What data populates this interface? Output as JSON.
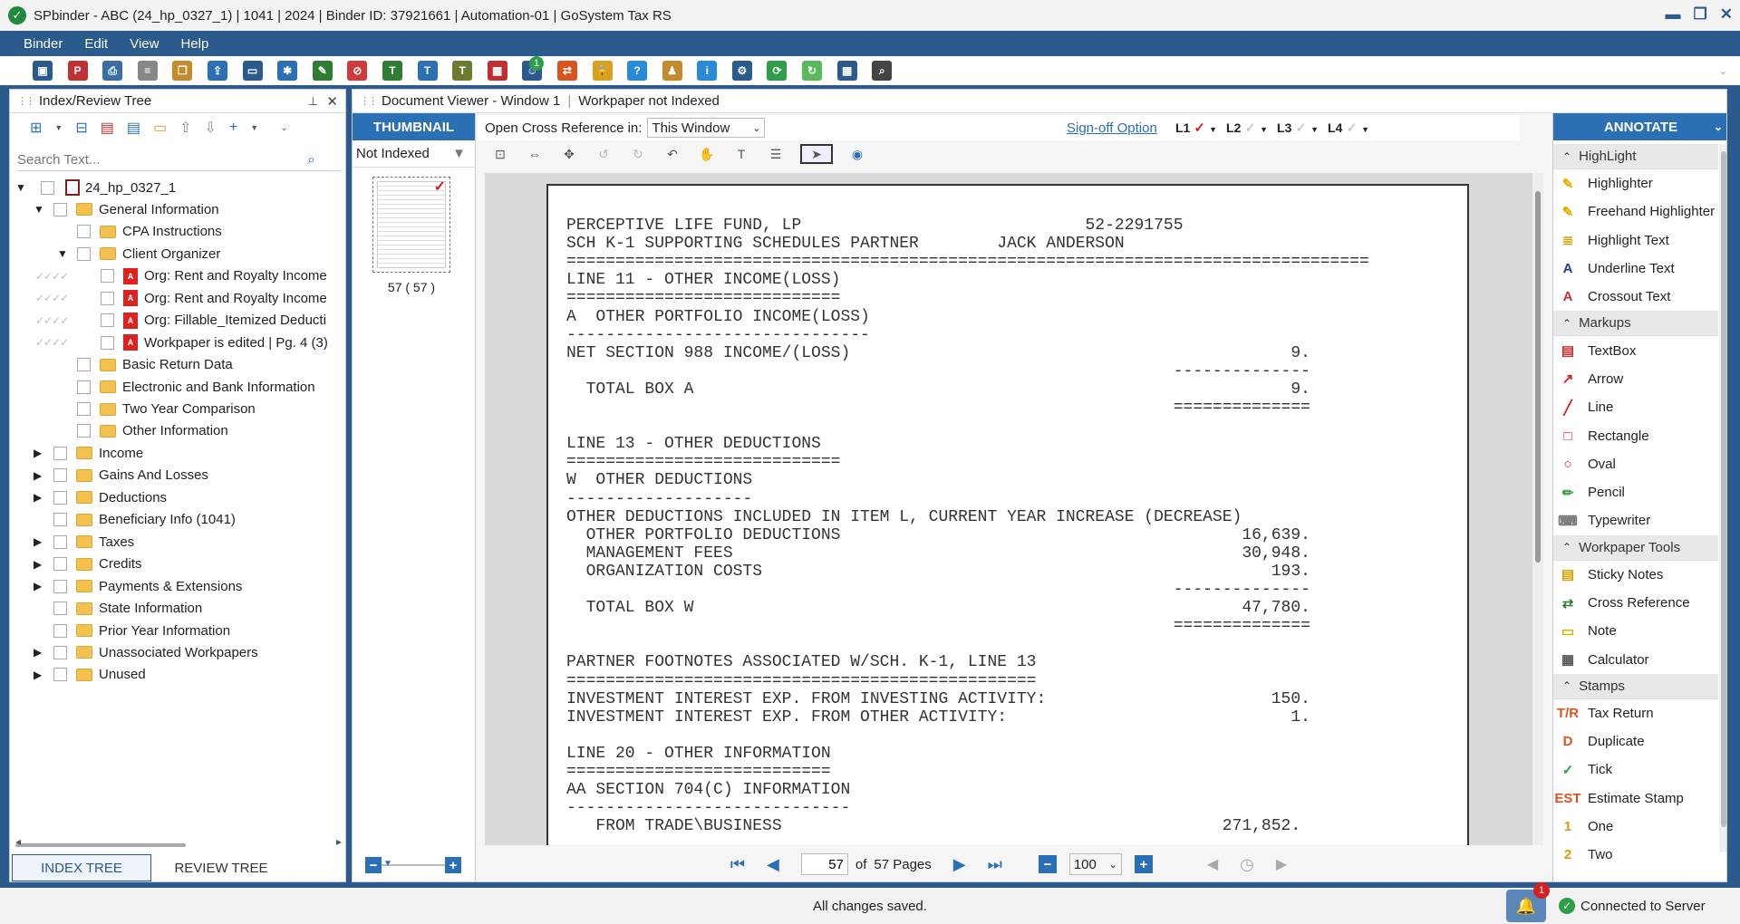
{
  "window": {
    "title": "SPbinder - ABC (24_hp_0327_1) | 1041 | 2024 | Binder ID: 37921661 | Automation-01 | GoSystem Tax RS",
    "controls": [
      "▬",
      "❐",
      "✕"
    ]
  },
  "menu": [
    "Binder",
    "Edit",
    "View",
    "Help"
  ],
  "toolbar": {
    "notification_count": "1",
    "icons": [
      {
        "name": "save-icon",
        "color": "#2b5a8c",
        "glyph": "▣"
      },
      {
        "name": "pdfx-icon",
        "color": "#c03030",
        "glyph": "P"
      },
      {
        "name": "print-icon",
        "color": "#3a6ea5",
        "glyph": "⎙"
      },
      {
        "name": "document-icon",
        "color": "#888",
        "glyph": "≡"
      },
      {
        "name": "copy-doc-icon",
        "color": "#c48a2c",
        "glyph": "❐"
      },
      {
        "name": "export-icon",
        "color": "#2b6fb5",
        "glyph": "⇪"
      },
      {
        "name": "monitor-icon",
        "color": "#2b5a8c",
        "glyph": "▭"
      },
      {
        "name": "tools-icon",
        "color": "#2b6fb5",
        "glyph": "✱"
      },
      {
        "name": "user-sign-icon",
        "color": "#2e7d32",
        "glyph": "✎"
      },
      {
        "name": "no-entry-icon",
        "color": "#d13a3a",
        "glyph": "⊘"
      },
      {
        "name": "tei-icon",
        "color": "#2e7d32",
        "glyph": "T"
      },
      {
        "name": "tax-icon",
        "color": "#2b6fb5",
        "glyph": "T"
      },
      {
        "name": "tr-icon",
        "color": "#6a7d2e",
        "glyph": "T"
      },
      {
        "name": "calendar-icon",
        "color": "#c03030",
        "glyph": "▦"
      },
      {
        "name": "users-icon",
        "color": "#2b5a8c",
        "glyph": "☺"
      },
      {
        "name": "swap-icon",
        "color": "#d9541e",
        "glyph": "⇄"
      },
      {
        "name": "lock-icon",
        "color": "#d9a020",
        "glyph": "🔒"
      },
      {
        "name": "help-icon",
        "color": "#2b8ad6",
        "glyph": "?"
      },
      {
        "name": "user-key-icon",
        "color": "#c48a2c",
        "glyph": "♟"
      },
      {
        "name": "info-icon",
        "color": "#2b8ad6",
        "glyph": "i"
      },
      {
        "name": "settings-icon",
        "color": "#2b5a8c",
        "glyph": "⚙"
      },
      {
        "name": "sync-icon",
        "color": "#2e9e4a",
        "glyph": "⟳"
      },
      {
        "name": "refresh-green-icon",
        "color": "#5cb85c",
        "glyph": "↻"
      },
      {
        "name": "grid-icon",
        "color": "#2b5a8c",
        "glyph": "▦"
      },
      {
        "name": "search-icon",
        "color": "#444",
        "glyph": "⌕"
      }
    ]
  },
  "index_panel": {
    "title": "Index/Review Tree",
    "search_placeholder": "Search Text...",
    "tabs": [
      "INDEX TREE",
      "REVIEW TREE"
    ],
    "root": "24_hp_0327_1",
    "items": [
      {
        "label": "General Information",
        "level": 1,
        "expander": "▼",
        "type": "folder"
      },
      {
        "label": "CPA Instructions",
        "level": 2,
        "expander": "",
        "type": "folder"
      },
      {
        "label": "Client Organizer",
        "level": 2,
        "expander": "▼",
        "type": "folder"
      },
      {
        "label": "Org: Rent and Royalty Income",
        "level": 3,
        "expander": "",
        "type": "pdf",
        "sig": "✓✓✓✓"
      },
      {
        "label": "Org: Rent and Royalty Income",
        "level": 3,
        "expander": "",
        "type": "pdf",
        "sig": "✓✓✓✓"
      },
      {
        "label": "Org: Fillable_Itemized Deducti",
        "level": 3,
        "expander": "",
        "type": "pdf",
        "sig": "✓✓✓✓"
      },
      {
        "label": "Workpaper is edited  | Pg. 4 (3)",
        "level": 3,
        "expander": "",
        "type": "pdf",
        "sig": "✓✓✓✓"
      },
      {
        "label": "Basic Return Data",
        "level": 2,
        "expander": "",
        "type": "folder"
      },
      {
        "label": "Electronic and Bank Information",
        "level": 2,
        "expander": "",
        "type": "folder"
      },
      {
        "label": "Two Year Comparison",
        "level": 2,
        "expander": "",
        "type": "folder"
      },
      {
        "label": "Other Information",
        "level": 2,
        "expander": "",
        "type": "folder"
      },
      {
        "label": "Income",
        "level": 1,
        "expander": "▶",
        "type": "folder"
      },
      {
        "label": "Gains And Losses",
        "level": 1,
        "expander": "▶",
        "type": "folder"
      },
      {
        "label": "Deductions",
        "level": 1,
        "expander": "▶",
        "type": "folder"
      },
      {
        "label": "Beneficiary Info (1041)",
        "level": 1,
        "expander": "",
        "type": "folder"
      },
      {
        "label": "Taxes",
        "level": 1,
        "expander": "▶",
        "type": "folder"
      },
      {
        "label": "Credits",
        "level": 1,
        "expander": "▶",
        "type": "folder"
      },
      {
        "label": "Payments & Extensions",
        "level": 1,
        "expander": "▶",
        "type": "folder"
      },
      {
        "label": "State Information",
        "level": 1,
        "expander": "",
        "type": "folder"
      },
      {
        "label": "Prior Year Information",
        "level": 1,
        "expander": "",
        "type": "folder"
      },
      {
        "label": "Unassociated Workpapers",
        "level": 1,
        "expander": "▶",
        "type": "folder"
      },
      {
        "label": "Unused",
        "level": 1,
        "expander": "▶",
        "type": "folder"
      }
    ]
  },
  "viewer": {
    "title": "Document Viewer - Window 1",
    "status": "Workpaper not Indexed",
    "thumbnail_tab": "THUMBNAIL",
    "filter_label": "Not Indexed",
    "thumb_caption": "57 ( 57 )",
    "cross_ref_label": "Open Cross Reference in:",
    "cross_ref_value": "This Window",
    "signoff_label": "Sign-off Option",
    "levels": [
      "L1",
      "L2",
      "L3",
      "L4"
    ],
    "page_current": "57",
    "page_of": "of",
    "page_total": "57 Pages",
    "zoom": "100",
    "doc_lines": [
      "PERCEPTIVE LIFE FUND, LP                             52-2291755",
      "SCH K-1 SUPPORTING SCHEDULES PARTNER        JACK ANDERSON",
      "==================================================================================",
      "LINE 11 - OTHER INCOME(LOSS)",
      "============================",
      "A  OTHER PORTFOLIO INCOME(LOSS)",
      "-------------------------------",
      "NET SECTION 988 INCOME/(LOSS)                                             9.",
      "                                                              --------------",
      "  TOTAL BOX A                                                             9.",
      "                                                              ==============",
      "",
      "LINE 13 - OTHER DEDUCTIONS",
      "============================",
      "W  OTHER DEDUCTIONS",
      "-------------------",
      "OTHER DEDUCTIONS INCLUDED IN ITEM L, CURRENT YEAR INCREASE (DECREASE)",
      "  OTHER PORTFOLIO DEDUCTIONS                                         16,639.",
      "  MANAGEMENT FEES                                                    30,948.",
      "  ORGANIZATION COSTS                                                    193.",
      "                                                              --------------",
      "  TOTAL BOX W                                                        47,780.",
      "                                                              ==============",
      "",
      "PARTNER FOOTNOTES ASSOCIATED W/SCH. K-1, LINE 13",
      "================================================",
      "INVESTMENT INTEREST EXP. FROM INVESTING ACTIVITY:                       150.",
      "INVESTMENT INTEREST EXP. FROM OTHER ACTIVITY:                             1.",
      "",
      "LINE 20 - OTHER INFORMATION",
      "===========================",
      "AA SECTION 704(C) INFORMATION",
      "-----------------------------",
      "   FROM TRADE\\BUSINESS                                             271,852."
    ]
  },
  "annotate": {
    "title": "ANNOTATE",
    "groups": [
      {
        "header": "HighLight",
        "items": [
          {
            "label": "Highlighter",
            "icon": "highlighter-icon",
            "color": "#e0b000",
            "glyph": "✎"
          },
          {
            "label": "Freehand Highlighter",
            "icon": "freehand-highlighter-icon",
            "color": "#e0b000",
            "glyph": "✎"
          },
          {
            "label": "Highlight Text",
            "icon": "highlight-text-icon",
            "color": "#d4a000",
            "glyph": "≣"
          },
          {
            "label": "Underline Text",
            "icon": "underline-text-icon",
            "color": "#2b3a8c",
            "glyph": "A"
          },
          {
            "label": "Crossout Text",
            "icon": "crossout-text-icon",
            "color": "#c03030",
            "glyph": "A"
          }
        ]
      },
      {
        "header": "Markups",
        "items": [
          {
            "label": "TextBox",
            "icon": "textbox-icon",
            "color": "#c03030",
            "glyph": "▤"
          },
          {
            "label": "Arrow",
            "icon": "arrow-icon",
            "color": "#d42020",
            "glyph": "↗"
          },
          {
            "label": "Line",
            "icon": "line-icon",
            "color": "#d42020",
            "glyph": "╱"
          },
          {
            "label": "Rectangle",
            "icon": "rectangle-icon",
            "color": "#d42020",
            "glyph": "□"
          },
          {
            "label": "Oval",
            "icon": "oval-icon",
            "color": "#d42020",
            "glyph": "○"
          },
          {
            "label": "Pencil",
            "icon": "pencil-icon",
            "color": "#3aa04a",
            "glyph": "✏"
          },
          {
            "label": "Typewriter",
            "icon": "typewriter-icon",
            "color": "#777",
            "glyph": "⌨"
          }
        ]
      },
      {
        "header": "Workpaper Tools",
        "items": [
          {
            "label": "Sticky Notes",
            "icon": "sticky-notes-icon",
            "color": "#d4a000",
            "glyph": "▤"
          },
          {
            "label": "Cross Reference",
            "icon": "cross-reference-icon",
            "color": "#2e7d32",
            "glyph": "⇄"
          },
          {
            "label": "Note",
            "icon": "note-icon",
            "color": "#e0b000",
            "glyph": "▭"
          },
          {
            "label": "Calculator",
            "icon": "calculator-icon",
            "color": "#555",
            "glyph": "▦"
          }
        ]
      },
      {
        "header": "Stamps",
        "items": [
          {
            "label": "Tax Return",
            "icon": "tax-return-stamp-icon",
            "color": "#d9541e",
            "glyph": "T/R"
          },
          {
            "label": "Duplicate",
            "icon": "duplicate-stamp-icon",
            "color": "#d9541e",
            "glyph": "D"
          },
          {
            "label": "Tick",
            "icon": "tick-stamp-icon",
            "color": "#2e9e4a",
            "glyph": "✓"
          },
          {
            "label": "Estimate Stamp",
            "icon": "estimate-stamp-icon",
            "color": "#d9541e",
            "glyph": "EST"
          },
          {
            "label": "One",
            "icon": "one-stamp-icon",
            "color": "#d4a000",
            "glyph": "1"
          },
          {
            "label": "Two",
            "icon": "two-stamp-icon",
            "color": "#d4a000",
            "glyph": "2"
          }
        ]
      }
    ]
  },
  "status": {
    "message": "All changes saved.",
    "connection": "Connected to Server",
    "alert_count": "1"
  }
}
